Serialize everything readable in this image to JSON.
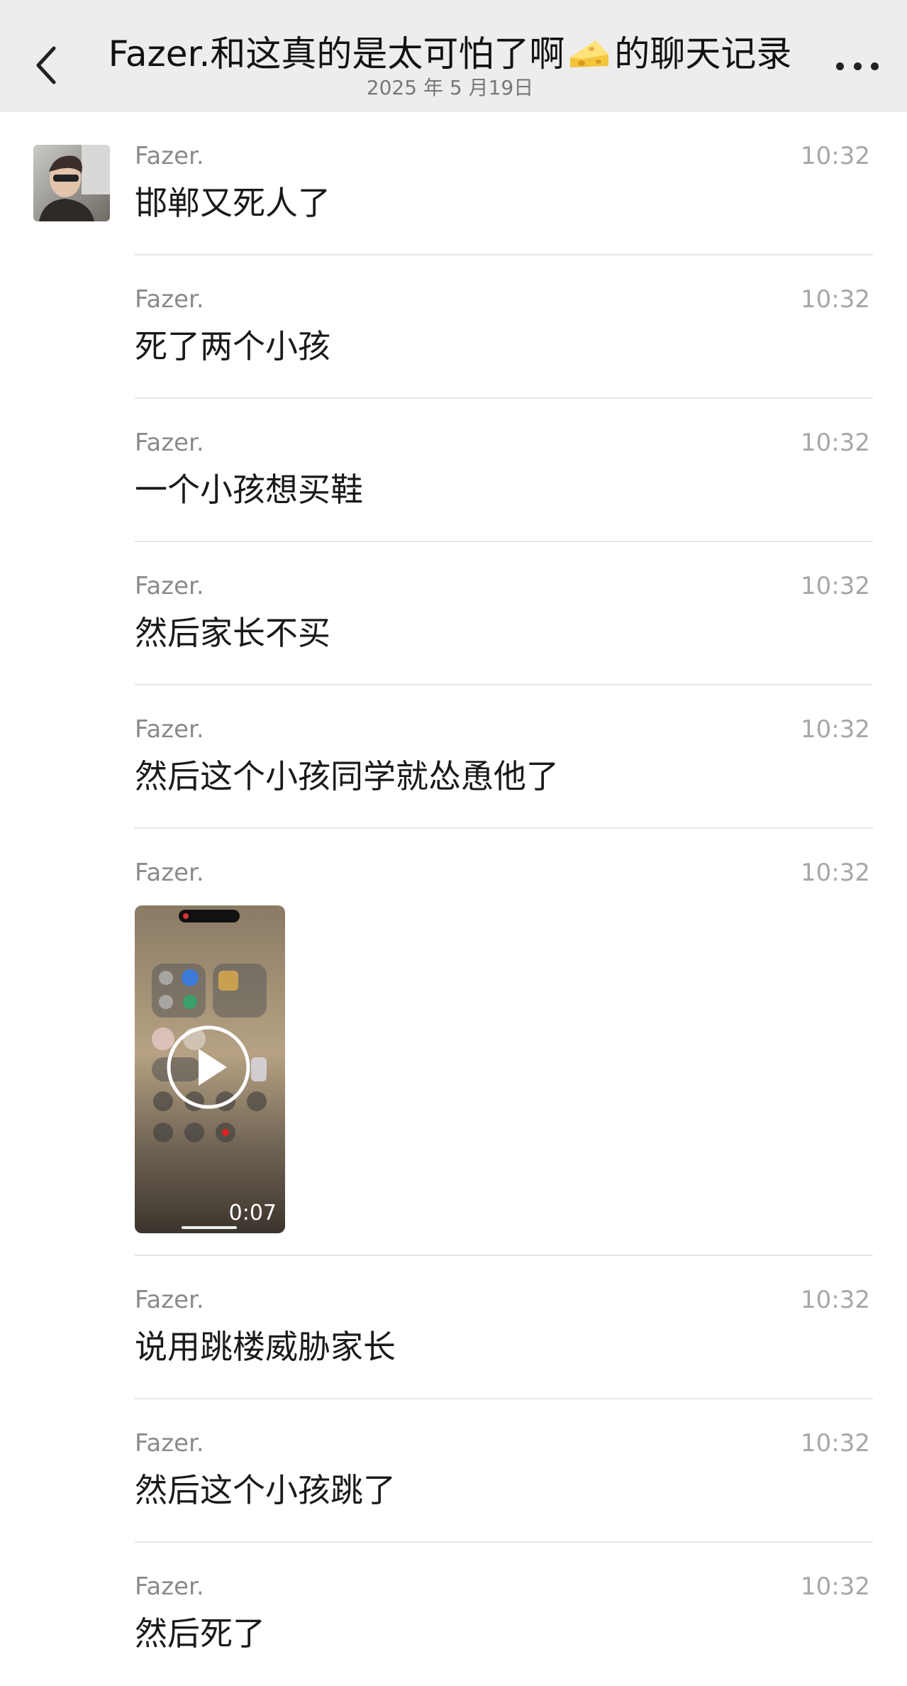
{
  "header": {
    "title_prefix": "Fazer.和这真的是太可怕了啊",
    "title_emoji": "cheese-emoji",
    "title_suffix": "的聊天记录",
    "date": "2025 年 5 月19日",
    "back_icon": "chevron-left-icon",
    "more_icon": "more-dots-icon"
  },
  "messages": [
    {
      "sender": "Fazer.",
      "time": "10:32",
      "text": "邯郸又死人了"
    },
    {
      "sender": "Fazer.",
      "time": "10:32",
      "text": "死了两个小孩"
    },
    {
      "sender": "Fazer.",
      "time": "10:32",
      "text": "一个小孩想买鞋"
    },
    {
      "sender": "Fazer.",
      "time": "10:32",
      "text": "然后家长不买"
    },
    {
      "sender": "Fazer.",
      "time": "10:32",
      "text": "然后这个小孩同学就怂恿他了"
    },
    {
      "sender": "Fazer.",
      "time": "10:32",
      "video_duration": "0:07"
    },
    {
      "sender": "Fazer.",
      "time": "10:32",
      "text": "说用跳楼威胁家长"
    },
    {
      "sender": "Fazer.",
      "time": "10:32",
      "text": "然后这个小孩跳了"
    },
    {
      "sender": "Fazer.",
      "time": "10:32",
      "text": "然后死了"
    }
  ],
  "colors": {
    "header_bg": "#ededed",
    "divider": "#e6e6e6",
    "sender_text": "#8a8a8a",
    "time_text": "#a7a7a7"
  }
}
